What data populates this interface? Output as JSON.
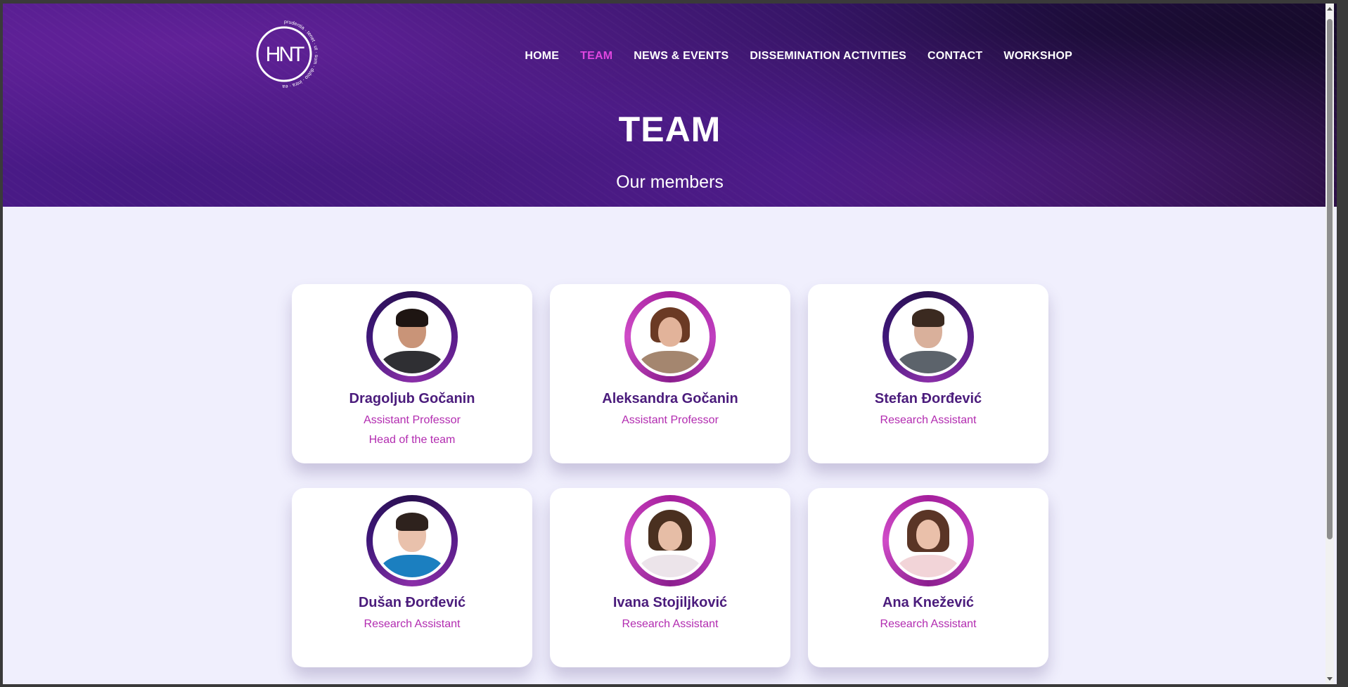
{
  "nav": {
    "items": [
      {
        "label": "HOME",
        "active": false
      },
      {
        "label": "TEAM",
        "active": true
      },
      {
        "label": "NEWS & EVENTS",
        "active": false
      },
      {
        "label": "DISSEMINATION ACTIVITIES",
        "active": false
      },
      {
        "label": "CONTACT",
        "active": false
      },
      {
        "label": "WORKSHOP",
        "active": false
      }
    ]
  },
  "logo": {
    "text": "HNT",
    "ring_text": "prudentia · tenet · ut · sum · dubio · intra · ea"
  },
  "hero": {
    "title": "TEAM",
    "subtitle": "Our members"
  },
  "members": [
    {
      "name": "Dragoljub Gočanin",
      "role": "Assistant Professor",
      "role2": "Head of the team"
    },
    {
      "name": "Aleksandra Gočanin",
      "role": "Assistant Professor",
      "role2": ""
    },
    {
      "name": "Stefan Đorđević",
      "role": "Research Assistant",
      "role2": ""
    },
    {
      "name": "Dušan Đorđević",
      "role": "Research Assistant",
      "role2": ""
    },
    {
      "name": "Ivana Stojiljković",
      "role": "Research Assistant",
      "role2": ""
    },
    {
      "name": "Ana Knežević",
      "role": "Research Assistant",
      "role2": ""
    }
  ],
  "colors": {
    "accent": "#e046e0",
    "name_color": "#4b1c7c",
    "role_color": "#b22bb0",
    "page_bg": "#f0effd"
  }
}
